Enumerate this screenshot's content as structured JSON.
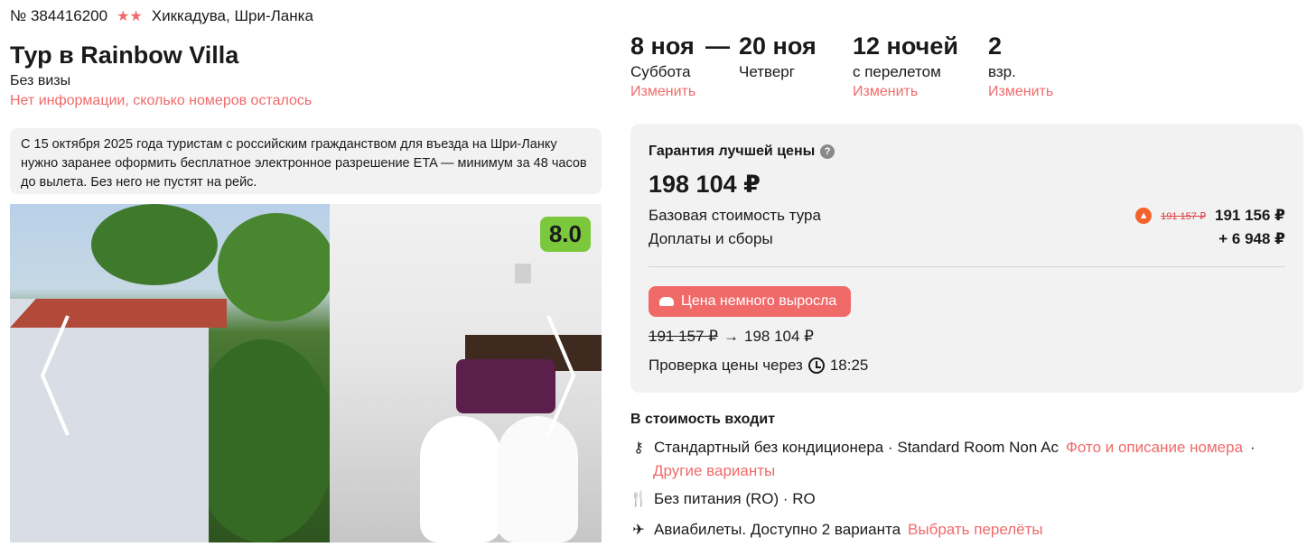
{
  "tour": {
    "number": "№ 384416200",
    "stars": "★★",
    "location": "Хиккадува, Шри-Ланка",
    "title": "Тур в Rainbow Villa",
    "visa": "Без визы",
    "rooms_info": "Нет информации, сколько номеров осталось",
    "notice": "С 15 октября 2025 года туристам с российским гражданством для въезда на Шри-Ланку нужно заранее оформить бесплатное электронное разрешение ETA — минимум за 48 часов до вылета. Без него не пустят на рейс.",
    "rating": "8.0"
  },
  "dates": {
    "from": "8 ноя",
    "from_day": "Суббота",
    "to": "20 ноя",
    "to_day": "Четверг",
    "nights": "12 ночей",
    "nights_sub": "с перелетом",
    "adults": "2",
    "adults_sub": "взр.",
    "change_label": "Изменить",
    "dash": "—"
  },
  "price": {
    "guarantee": "Гарантия лучшей цены",
    "total": "198 104 ₽",
    "base_label": "Базовая стоимость тура",
    "base_old": "191 157 ₽",
    "base_new": "191 156 ₽",
    "fees_label": "Доплаты и сборы",
    "fees_value": "+ 6 948 ₽",
    "increase_badge": "Цена немного выросла",
    "change_old": "191 157 ₽",
    "change_arrow": "→",
    "change_new": "198 104 ₽",
    "check_label": "Проверка цены через",
    "check_time": "18:25"
  },
  "includes": {
    "title": "В стоимость входит",
    "room_text": "Стандартный без кондиционера · Standard Room Non Ac",
    "room_link": "Фото и описание номера",
    "room_sep": "·",
    "other_variants": "Другие варианты",
    "meal_text": "Без питания (RO) · RO",
    "flights_text": "Авиабилеты. Доступно 2 варианта",
    "flights_link": "Выбрать перелёты"
  },
  "colors": {
    "accent": "#f06a6a",
    "rating_bg": "#7cc83c",
    "panel_bg": "#f2f2f2"
  },
  "icons": [
    "star-icon",
    "question-icon",
    "fire-icon",
    "cloud-icon",
    "clock-icon",
    "key-icon",
    "fork-knife-icon",
    "plane-icon",
    "chevron-left-icon",
    "chevron-right-icon"
  ]
}
